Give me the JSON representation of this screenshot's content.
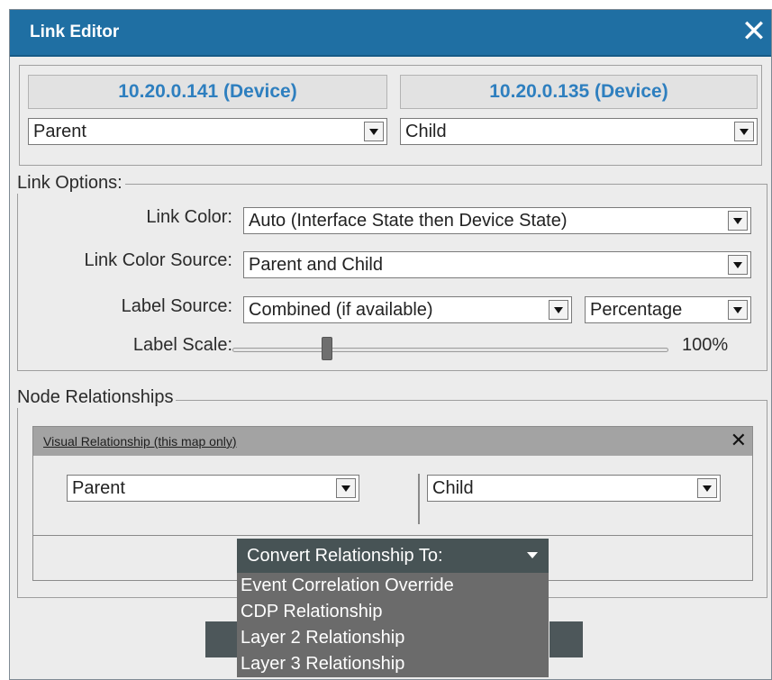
{
  "window": {
    "title": "Link Editor"
  },
  "devices": {
    "left": {
      "name": "10.20.0.141 (Device)",
      "role": "Parent"
    },
    "right": {
      "name": "10.20.0.135 (Device)",
      "role": "Child"
    }
  },
  "link_options": {
    "legend": "Link Options:",
    "link_color": {
      "label": "Link Color:",
      "value": "Auto (Interface State then Device State)"
    },
    "link_color_source": {
      "label": "Link Color Source:",
      "value": "Parent and Child"
    },
    "label_source": {
      "label": "Label Source:",
      "value": "Combined (if available)",
      "format_value": "Percentage"
    },
    "label_scale": {
      "label": "Label Scale:",
      "value_text": "100%",
      "slider_fraction": 0.21
    }
  },
  "node_relationships": {
    "legend": "Node Relationships",
    "visual": {
      "title": "Visual Relationship (this map only)",
      "left_role": "Parent",
      "right_role": "Child"
    },
    "convert": {
      "label": "Convert Relationship To:",
      "options": [
        "Event Correlation Override",
        "CDP Relationship",
        "Layer 2 Relationship",
        "Layer 3 Relationship"
      ]
    }
  },
  "colors": {
    "titlebar": "#1f6fa3",
    "device_name": "#2e7fbf",
    "convert_button": "#475355",
    "menu": "#6b6b6b"
  },
  "icons": {
    "close": "close-icon",
    "dropdown": "chevron-down-icon"
  }
}
